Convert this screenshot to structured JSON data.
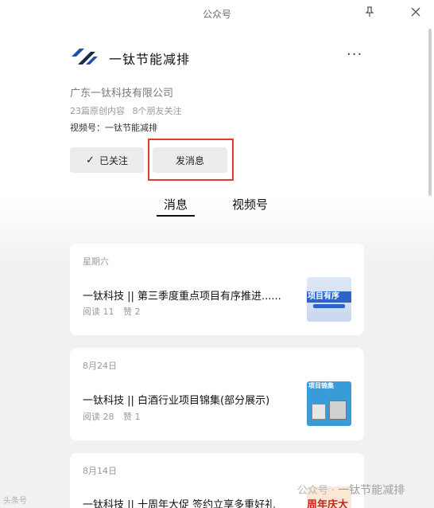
{
  "window": {
    "title": "公众号"
  },
  "account": {
    "name": "一钛节能减排",
    "company": "广东一钛科技有限公司",
    "stats": {
      "original": "23篇原创内容",
      "friends": "8个朋友关注"
    },
    "channel": "视频号：一钛节能减排"
  },
  "actions": {
    "followed_label": "已关注",
    "message_label": "发消息"
  },
  "tabs": [
    {
      "label": "消息",
      "selected": true
    },
    {
      "label": "视频号",
      "selected": false
    }
  ],
  "posts": [
    {
      "date": "星期六",
      "title": "一钛科技 || 第三季度重点项目有序推进......",
      "reads": "阅读 11",
      "likes": "赞 2",
      "thumb_text": "项目有序"
    },
    {
      "date": "8月24日",
      "title": "一钛科技 || 白酒行业项目锦集(部分展示)",
      "reads": "阅读 28",
      "likes": "赞 1",
      "thumb_text": "项目锦集"
    },
    {
      "date": "8月14日",
      "title": "一钛科技 || 十周年大促 签约立享多重好礼",
      "thumb_text": "周年庆大"
    }
  ],
  "watermarks": {
    "left": "头条号",
    "right_prefix": "公众号 ·",
    "right_name": "一钛节能减排"
  },
  "colors": {
    "highlight": "#e23b33",
    "logo_blue": "#1f4fa8",
    "logo_dark": "#1b2a4a"
  }
}
